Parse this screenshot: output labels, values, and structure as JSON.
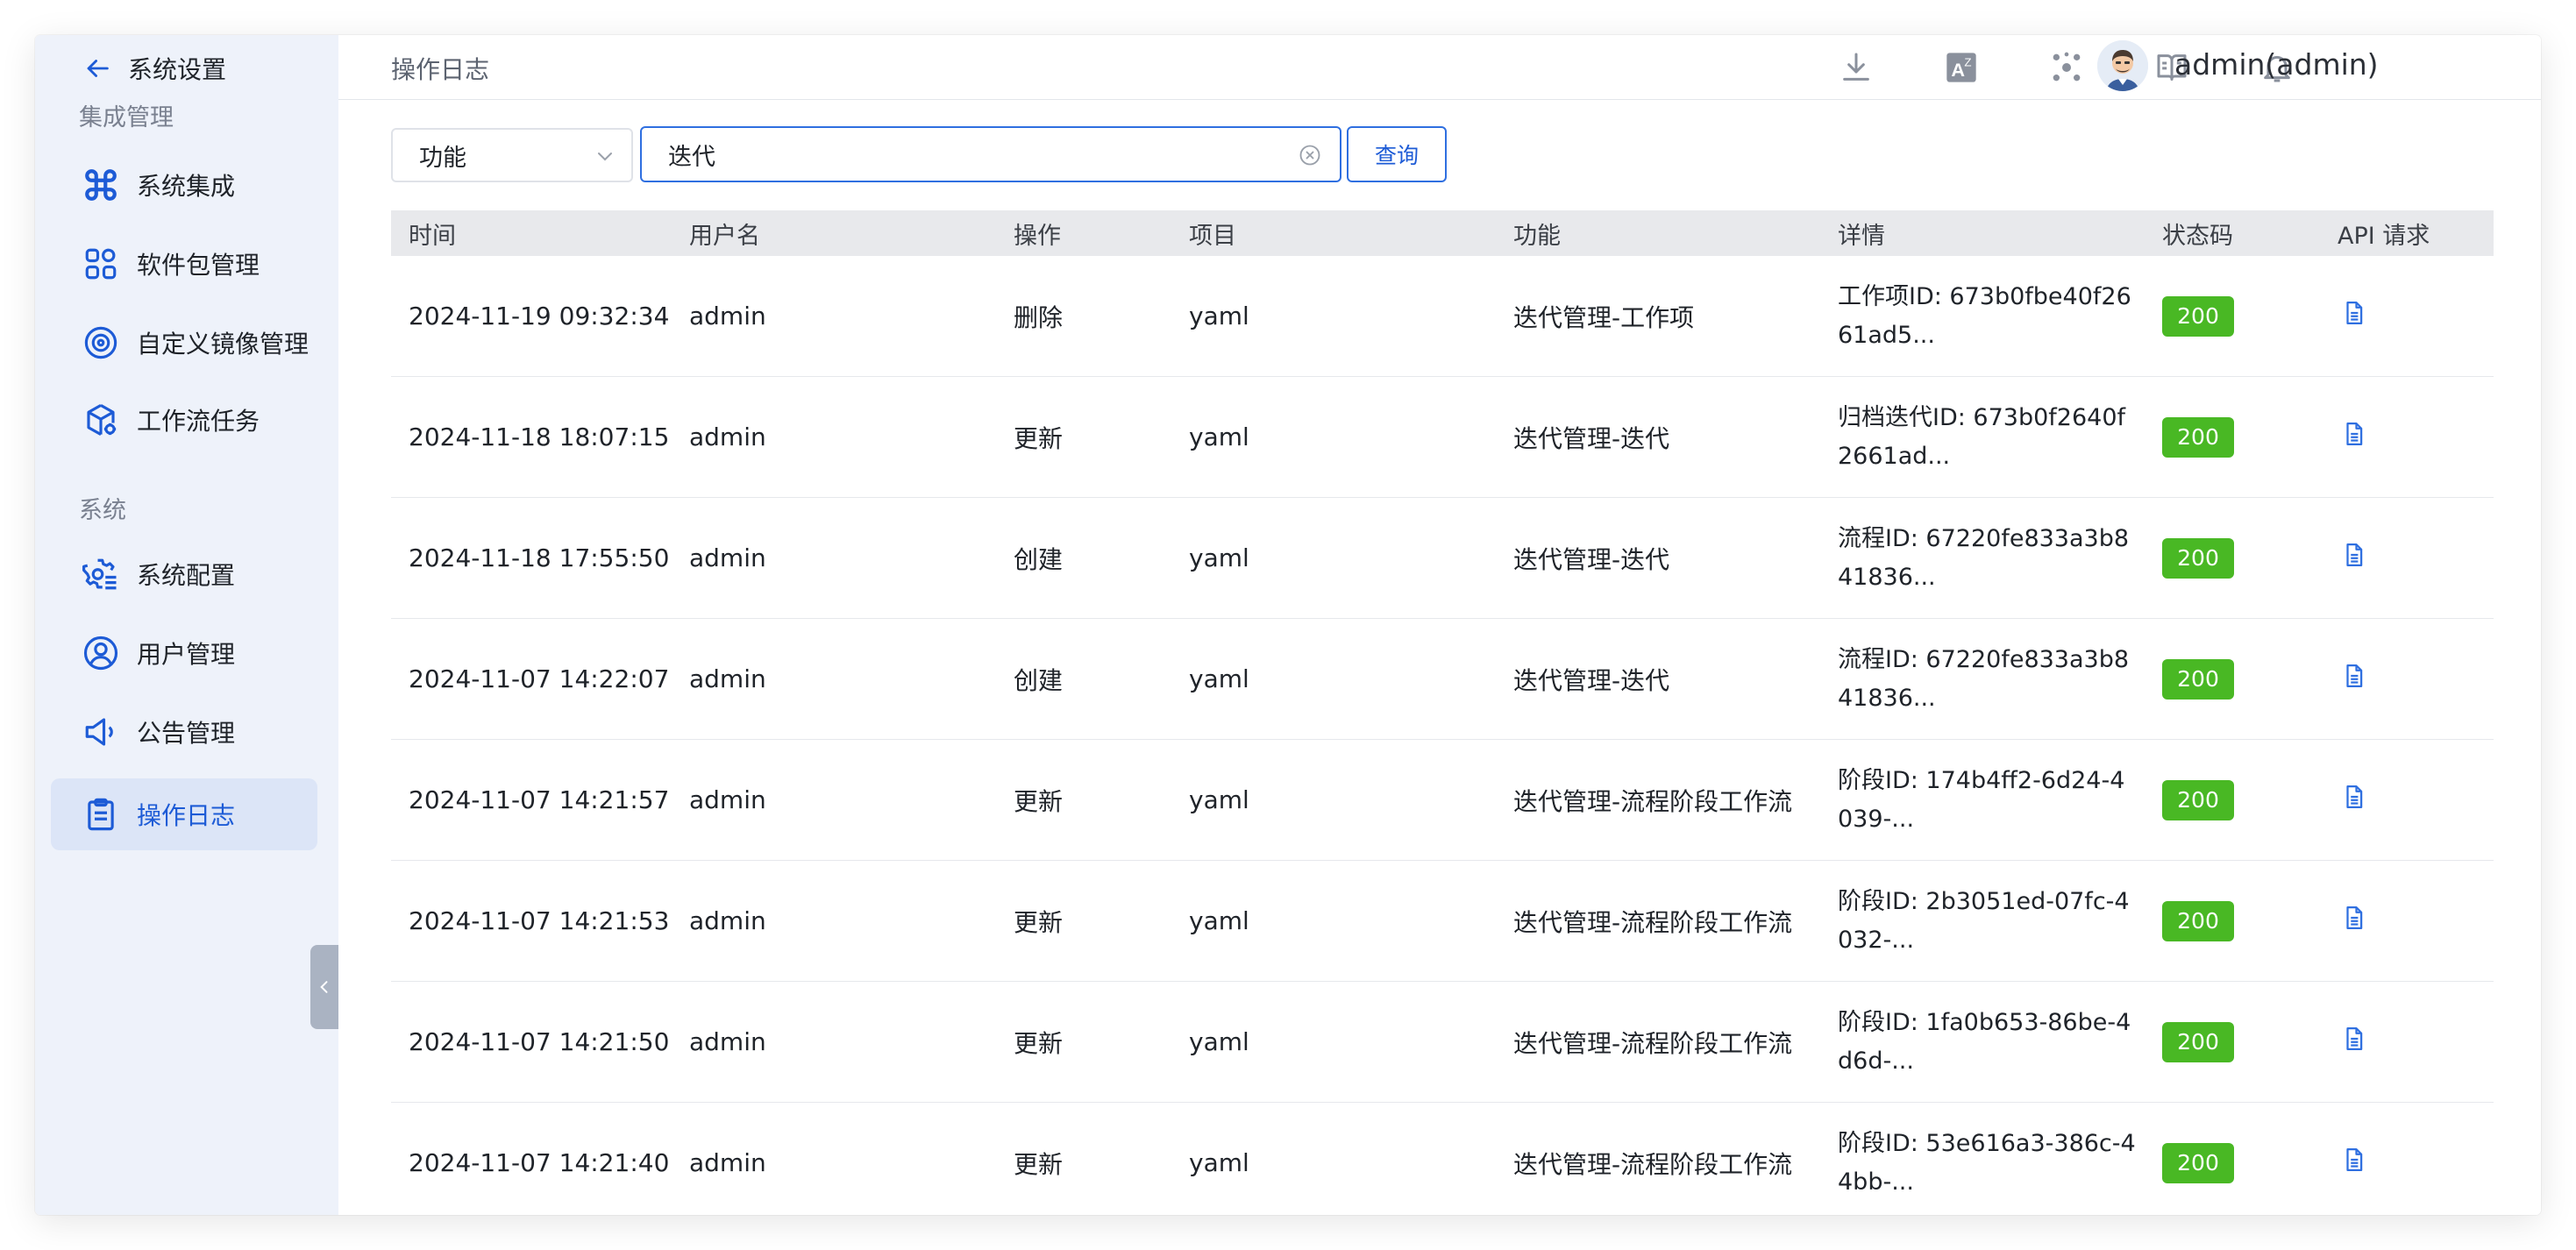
{
  "sidebar": {
    "back_label": "系统设置",
    "groups": [
      {
        "title": "集成管理"
      },
      {
        "title": "系统"
      }
    ],
    "items": [
      {
        "label": "系统集成",
        "icon": "command-icon"
      },
      {
        "label": "软件包管理",
        "icon": "grid-icon"
      },
      {
        "label": "自定义镜像管理",
        "icon": "disc-icon"
      },
      {
        "label": "工作流任务",
        "icon": "box-gear-icon"
      },
      {
        "label": "系统配置",
        "icon": "gear-list-icon"
      },
      {
        "label": "用户管理",
        "icon": "user-circle-icon"
      },
      {
        "label": "公告管理",
        "icon": "megaphone-icon"
      },
      {
        "label": "操作日志",
        "icon": "clipboard-icon",
        "active": true
      }
    ]
  },
  "header": {
    "title": "操作日志",
    "icons": [
      "download-icon",
      "translate-icon",
      "network-icon",
      "book-icon",
      "bell-icon"
    ],
    "user_name": "admin(admin)"
  },
  "filter": {
    "field": "功能",
    "search_value": "迭代",
    "query_label": "查询"
  },
  "table": {
    "columns": [
      "时间",
      "用户名",
      "操作",
      "项目",
      "功能",
      "详情",
      "状态码",
      "API 请求"
    ],
    "rows": [
      {
        "time": "2024-11-19 09:32:34",
        "user": "admin",
        "op": "删除",
        "project": "yaml",
        "func": "迭代管理-工作项",
        "detail": "工作项ID: 673b0fbe40f2661ad5...",
        "code": "200"
      },
      {
        "time": "2024-11-18 18:07:15",
        "user": "admin",
        "op": "更新",
        "project": "yaml",
        "func": "迭代管理-迭代",
        "detail": "归档迭代ID: 673b0f2640f2661ad...",
        "code": "200"
      },
      {
        "time": "2024-11-18 17:55:50",
        "user": "admin",
        "op": "创建",
        "project": "yaml",
        "func": "迭代管理-迭代",
        "detail": "流程ID: 67220fe833a3b841836...",
        "code": "200"
      },
      {
        "time": "2024-11-07 14:22:07",
        "user": "admin",
        "op": "创建",
        "project": "yaml",
        "func": "迭代管理-迭代",
        "detail": "流程ID: 67220fe833a3b841836...",
        "code": "200"
      },
      {
        "time": "2024-11-07 14:21:57",
        "user": "admin",
        "op": "更新",
        "project": "yaml",
        "func": "迭代管理-流程阶段工作流",
        "detail": "阶段ID: 174b4ff2-6d24-4039-...",
        "code": "200"
      },
      {
        "time": "2024-11-07 14:21:53",
        "user": "admin",
        "op": "更新",
        "project": "yaml",
        "func": "迭代管理-流程阶段工作流",
        "detail": "阶段ID: 2b3051ed-07fc-4032-...",
        "code": "200"
      },
      {
        "time": "2024-11-07 14:21:50",
        "user": "admin",
        "op": "更新",
        "project": "yaml",
        "func": "迭代管理-流程阶段工作流",
        "detail": "阶段ID: 1fa0b653-86be-4d6d-...",
        "code": "200"
      },
      {
        "time": "2024-11-07 14:21:40",
        "user": "admin",
        "op": "更新",
        "project": "yaml",
        "func": "迭代管理-流程阶段工作流",
        "detail": "阶段ID: 53e616a3-386c-44bb-...",
        "code": "200"
      }
    ]
  },
  "colors": {
    "accent": "#1d5bd6",
    "success": "#49b824",
    "sidebar_bg": "#eef2fa",
    "active_bg": "#dce5f7"
  }
}
